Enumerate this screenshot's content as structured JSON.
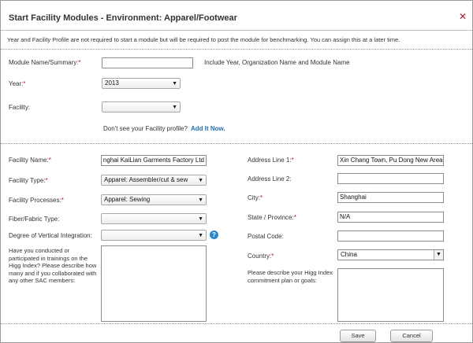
{
  "modal": {
    "title": "Start Facility Modules - Environment: Apparel/Footwear",
    "close_icon": "✕",
    "notice": "Year and Facility Profile are not required to start a module but will be required to post the module for benchmarking. You can assign this at a later time."
  },
  "module": {
    "name_label": "Module Name/Summary:",
    "name_value": "",
    "name_hint": "Include Year, Organization Name and Module Name",
    "year_label": "Year:",
    "year_value": "2013",
    "facility_label": "Facility:",
    "facility_value": "",
    "profile_question": "Don't see your Facility profile?",
    "add_link": "Add It Now."
  },
  "facility": {
    "name_label": "Facility Name:",
    "name_value": "nghai KaiLian Garments Factory Ltd",
    "type_label": "Facility Type:",
    "type_value": "Apparel: Assembler/cut & sew",
    "processes_label": "Facility Processes:",
    "processes_value": "Apparel: Sewing",
    "fiber_label": "Fiber/Fabric Type:",
    "fiber_value": "",
    "vertical_label": "Degree of Vertical Integration:",
    "vertical_value": "",
    "help_icon": "?",
    "trainings_question": "Have you conducted or participated in trainings on the Higg Index? Please describe how many and if you collaborated with any other SAC members:"
  },
  "address": {
    "line1_label": "Address Line 1:",
    "line1_value": "Xin Chang Town, Pu Dong New Area",
    "line2_label": "Address Line 2:",
    "line2_value": "",
    "city_label": "City:",
    "city_value": "Shanghai",
    "state_label": "State / Province:",
    "state_value": "N/A",
    "postal_label": "Postal Code:",
    "postal_value": "",
    "country_label": "Country:",
    "country_value": "China",
    "commitment_label": "Please describe your Higg Index commitment plan or goals:"
  },
  "buttons": {
    "save": "Save",
    "cancel": "Cancel"
  },
  "glyphs": {
    "required": "*",
    "caret": "▼"
  },
  "colors": {
    "required": "#c8102e",
    "close": "#b0142b",
    "link": "#1f6fb2",
    "help": "#2a88c9"
  }
}
